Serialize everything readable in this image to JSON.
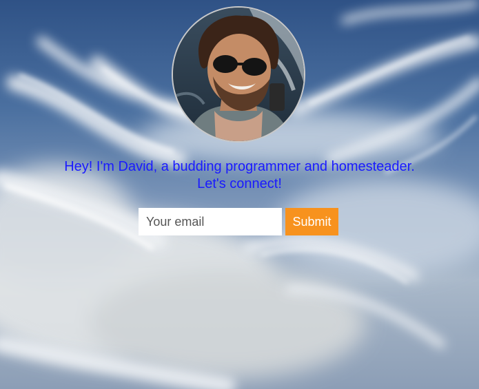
{
  "hero": {
    "intro_line1": "Hey! I'm David, a budding programmer and homesteader.",
    "intro_line2": "Let's connect!",
    "avatar_icon": "profile-photo"
  },
  "signup": {
    "email_placeholder": "Your email",
    "email_value": "",
    "submit_label": "Submit"
  },
  "colors": {
    "intro_text": "#1a1aff",
    "submit_bg": "#f7921e",
    "submit_text": "#ffffff",
    "sky": "#4b70a0"
  }
}
